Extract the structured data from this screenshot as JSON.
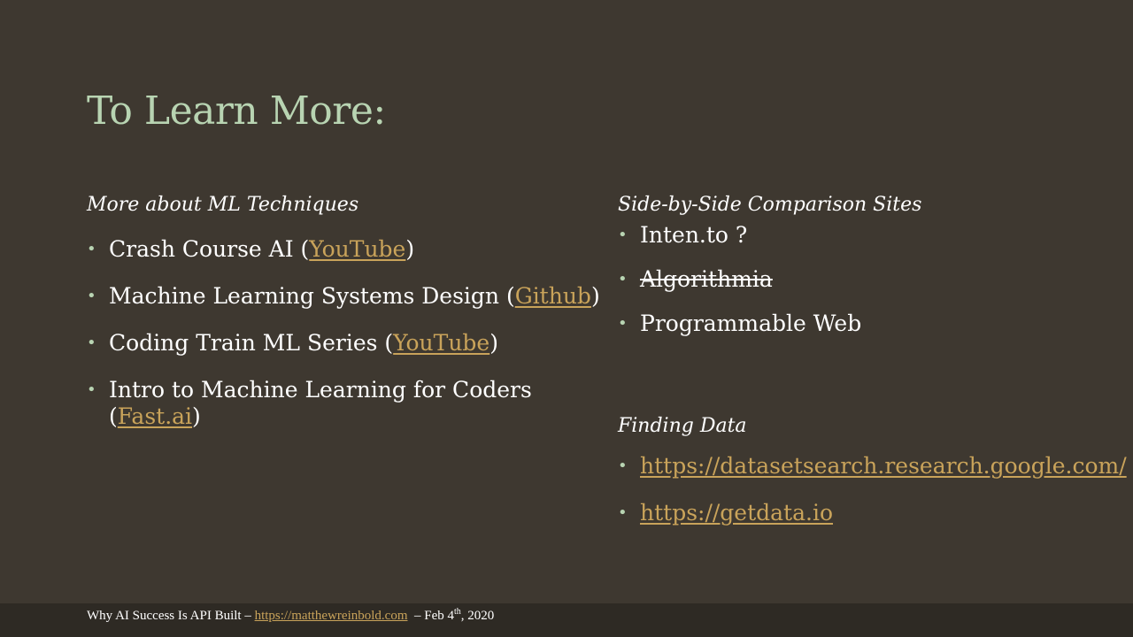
{
  "title": "To Learn More:",
  "left": {
    "heading": "More about ML Techniques",
    "items": [
      {
        "text": "Crash Course AI (",
        "link": "YouTube",
        "suffix": ")"
      },
      {
        "text": "Machine Learning Systems Design (",
        "link": "Github",
        "suffix": ")"
      },
      {
        "text": "Coding Train ML Series (",
        "link": "YouTube",
        "suffix": ")"
      },
      {
        "text": "Intro to Machine Learning for Coders (",
        "link": "Fast.ai",
        "suffix": ")"
      }
    ]
  },
  "right": {
    "heading": "Side-by-Side Comparison Sites",
    "items": [
      {
        "text": "Inten.to ?"
      },
      {
        "text": "Algorithmia"
      },
      {
        "text": "Programmable Web"
      }
    ]
  },
  "data": {
    "heading": "Finding Data",
    "links": [
      "https://datasetsearch.research.google.com/",
      "https://getdata.io"
    ]
  },
  "footer": {
    "prefix": "Why AI Success  Is API Built –",
    "link": "https://matthewreinbold.com",
    "date_prefix": "– Feb 4",
    "date_sup": "th",
    "date_suffix": ", 2020"
  },
  "colors": {
    "background": "#3e3830",
    "title": "#b8d4b2",
    "link": "#c9a35a",
    "footer_bar": "#2e2a24"
  }
}
